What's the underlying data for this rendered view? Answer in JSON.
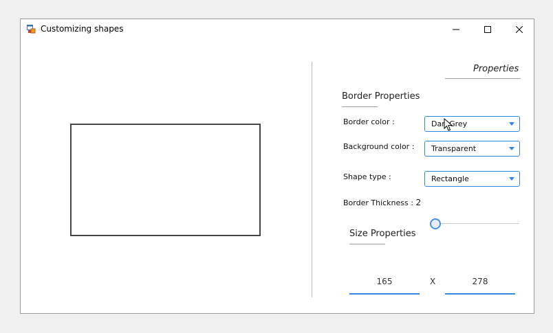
{
  "window": {
    "title": "Customizing shapes",
    "controls": [
      "minimize-icon",
      "maximize-icon",
      "close-icon"
    ]
  },
  "properties": {
    "title": "Properties",
    "border_section": {
      "title": "Border Properties",
      "border_color_label": "Border color :",
      "border_color_value": "DarkGrey",
      "background_color_label": "Background color :",
      "background_color_value": "Transparent",
      "shape_type_label": "Shape type :",
      "shape_type_value": "Rectangle",
      "thickness_label": "Border Thickness :",
      "thickness_value": "2"
    },
    "size_section": {
      "title": "Size Properties",
      "width": "165",
      "separator": "X",
      "height": "278"
    }
  },
  "colors": {
    "accent": "#2e86de",
    "shape_border": "#454545"
  }
}
